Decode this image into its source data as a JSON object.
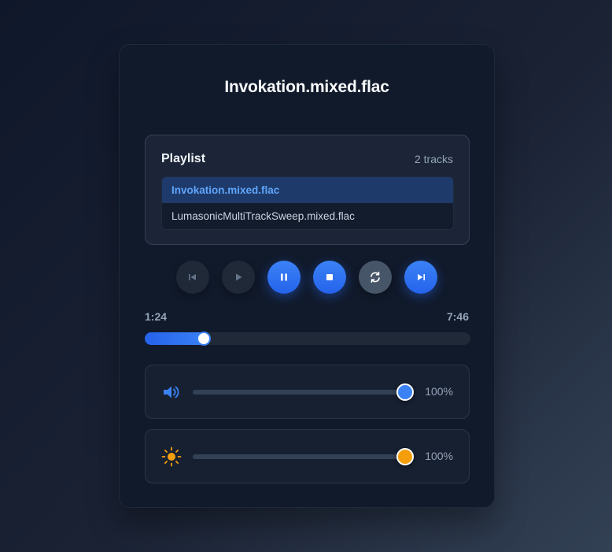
{
  "player": {
    "title": "Invokation.mixed.flac"
  },
  "playlist": {
    "heading": "Playlist",
    "count_label": "2 tracks",
    "tracks": [
      {
        "name": "Invokation.mixed.flac",
        "active": true
      },
      {
        "name": "LumasonicMultiTrackSweep.mixed.flac",
        "active": false
      }
    ]
  },
  "controls": {
    "buttons": [
      {
        "name": "previous-button",
        "icon": "skip-back-icon",
        "state": "disabled"
      },
      {
        "name": "play-button",
        "icon": "play-icon",
        "state": "disabled"
      },
      {
        "name": "pause-button",
        "icon": "pause-icon",
        "state": "primary"
      },
      {
        "name": "stop-button",
        "icon": "stop-icon",
        "state": "primary"
      },
      {
        "name": "loop-button",
        "icon": "repeat-icon",
        "state": "neutral"
      },
      {
        "name": "next-button",
        "icon": "skip-forward-icon",
        "state": "primary"
      }
    ]
  },
  "progress": {
    "current_time": "1:24",
    "total_time": "7:46",
    "fraction": 0.18
  },
  "volume": {
    "icon": "speaker-icon",
    "value_label": "100%",
    "level": 1.0,
    "color": "#3b82f6"
  },
  "brightness": {
    "icon": "sun-icon",
    "value_label": "100%",
    "level": 1.0,
    "color": "#f59e0b"
  },
  "colors": {
    "accent": "#3b82f6",
    "brightness_accent": "#f59e0b",
    "active_track_text": "#60a5fa"
  }
}
